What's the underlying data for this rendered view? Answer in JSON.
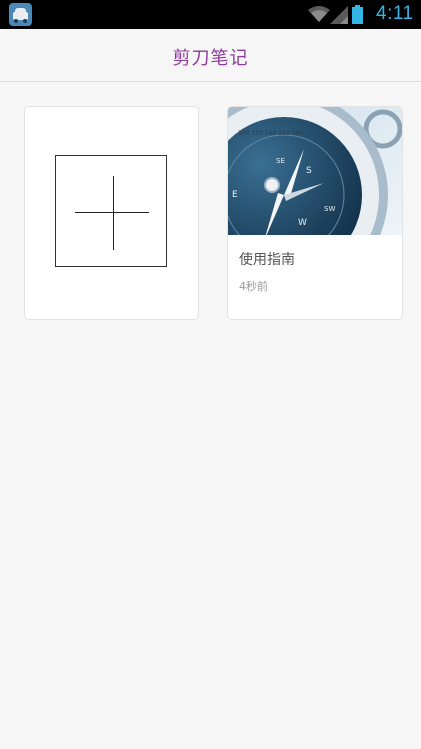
{
  "status_bar": {
    "time": "4:11",
    "icons": [
      "app-notification-icon",
      "wifi-icon",
      "cell-signal-icon",
      "battery-icon"
    ],
    "accent_color": "#33b5e5"
  },
  "header": {
    "title": "剪刀笔记",
    "title_color": "#8d3a9c"
  },
  "notes": [
    {
      "title": "使用指南",
      "time": "4秒前",
      "thumbnail": "compass-image"
    }
  ],
  "add_card": {
    "icon": "plus-icon"
  }
}
